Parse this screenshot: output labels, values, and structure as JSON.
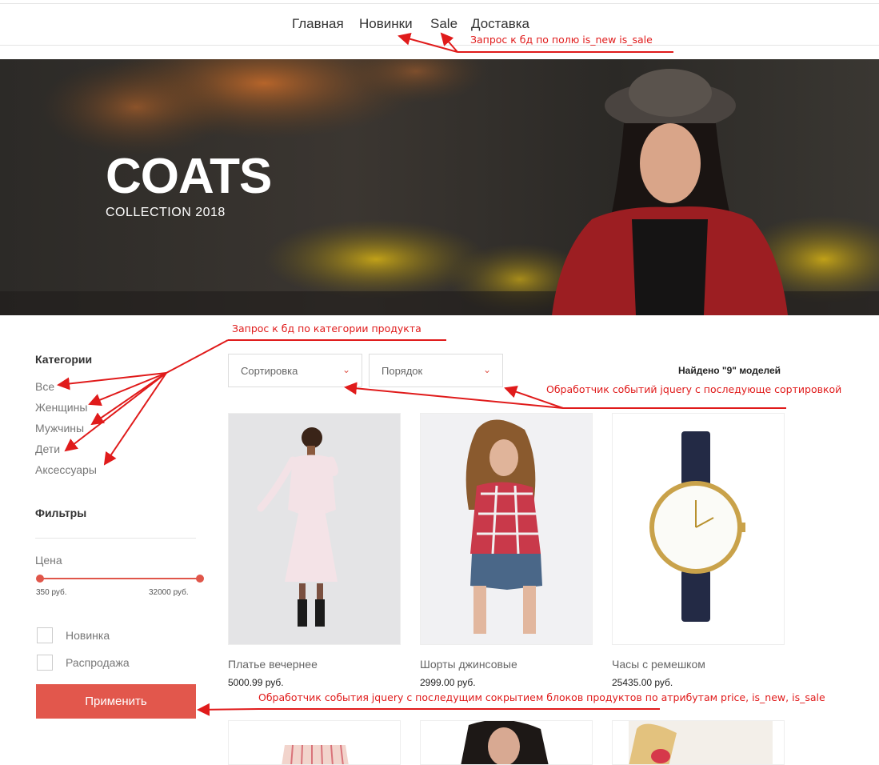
{
  "nav": {
    "items": [
      "Главная",
      "Новинки",
      "Sale",
      "Доставка"
    ]
  },
  "hero": {
    "title": "COATS",
    "subtitle": "COLLECTION 2018"
  },
  "sidebar": {
    "categories_title": "Категории",
    "categories": [
      "Все",
      "Женщины",
      "Мужчины",
      "Дети",
      "Аксессуары"
    ],
    "filters_title": "Фильтры",
    "price_label": "Цена",
    "price_min": "350 руб.",
    "price_max": "32000 руб.",
    "checkboxes": [
      {
        "label": "Новинка",
        "checked": false
      },
      {
        "label": "Распродажа",
        "checked": false
      }
    ],
    "apply_label": "Применить"
  },
  "toolbar": {
    "sort_label": "Сортировка",
    "order_label": "Порядок",
    "found_text": "Найдено \"9\" моделей"
  },
  "products": [
    {
      "name": "Платье вечернее",
      "price": "5000.99 руб.",
      "icon": "dress-photo"
    },
    {
      "name": "Шорты джинсовые",
      "price": "2999.00 руб.",
      "icon": "shorts-photo"
    },
    {
      "name": "Часы с ремешком",
      "price": "25435.00 руб.",
      "icon": "watch-photo"
    }
  ],
  "annotations": {
    "nav_note": "Запрос к бд по полю is_new is_sale",
    "category_note": "Запрос к бд по категории продукта",
    "sort_note": "Обработчик событий jquery с последующе сортировкой",
    "filter_note": "Обработчик события jquery с последущим сокрытием блоков продуктов  по атрибутам price, is_new, is_sale"
  },
  "colors": {
    "accent": "#e2574c",
    "annotation": "#e01b1b"
  }
}
